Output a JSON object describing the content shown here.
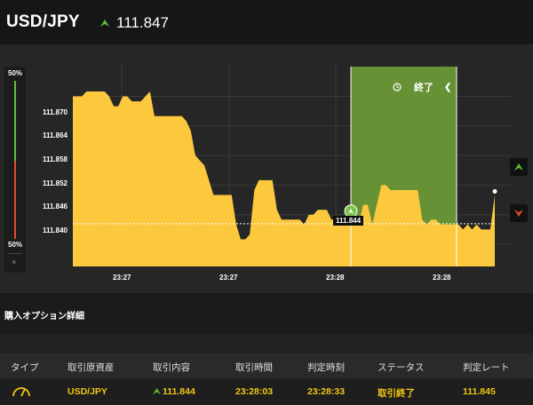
{
  "header": {
    "pair": "USD/JPY",
    "price": "111.847",
    "direction_icon": "up-arrow-icon",
    "up_color": "#5fbf3a"
  },
  "meter": {
    "top_label": "50%",
    "bottom_label": "50%",
    "close_label": "×"
  },
  "chart": {
    "y_ticks": [
      "111.870",
      "111.864",
      "111.858",
      "111.852",
      "111.846",
      "111.840"
    ],
    "x_ticks": [
      "23:27",
      "23:27",
      "23:28",
      "23:28"
    ],
    "current_label": "111.844",
    "end_label": "終了",
    "fill_color": "#fcc93e",
    "window_color": "#6b9a36"
  },
  "chart_data": {
    "type": "area",
    "y_tick_values": [
      111.87,
      111.864,
      111.858,
      111.852,
      111.846,
      111.84
    ],
    "ylim": [
      111.8355,
      111.8755
    ],
    "x_ticks": [
      "23:27",
      "23:27",
      "23:28",
      "23:28"
    ],
    "series": [
      {
        "values": [
          111.87,
          111.87,
          111.87,
          111.871,
          111.871,
          111.871,
          111.871,
          111.871,
          111.87,
          111.868,
          111.868,
          111.87,
          111.87,
          111.869,
          111.869,
          111.869,
          111.87,
          111.871,
          111.866,
          111.866,
          111.866,
          111.866,
          111.866,
          111.866,
          111.866,
          111.865,
          111.863,
          111.858,
          111.857,
          111.856,
          111.853,
          111.85,
          111.85,
          111.85,
          111.85,
          111.85,
          111.844,
          111.841,
          111.841,
          111.842,
          111.851,
          111.853,
          111.853,
          111.853,
          111.853,
          111.847,
          111.845,
          111.845,
          111.845,
          111.845,
          111.845,
          111.844,
          111.846,
          111.846,
          111.847,
          111.847,
          111.847,
          111.845,
          111.845,
          111.844,
          111.844,
          111.845,
          111.844,
          111.844,
          111.848,
          111.848,
          111.844,
          111.848,
          111.852,
          111.852,
          111.851,
          111.851,
          111.851,
          111.851,
          111.851,
          111.851,
          111.851,
          111.845,
          111.844,
          111.845,
          111.845,
          111.844,
          111.844,
          111.844,
          111.844,
          111.844,
          111.843,
          111.844,
          111.843,
          111.844,
          111.843,
          111.843,
          111.843,
          111.85
        ]
      }
    ],
    "entry_value": 111.846,
    "current_value": 111.844,
    "last_value": 111.85
  },
  "side_buttons": {
    "up_icon": "up-arrow-icon",
    "down_icon": "down-arrow-icon",
    "down_color": "#e04b2b"
  },
  "section": {
    "title": "購入オプション詳細"
  },
  "table": {
    "headers": [
      "タイプ",
      "取引原資産",
      "取引内容",
      "取引時間",
      "判定時刻",
      "ステータス",
      "判定レート"
    ],
    "row": {
      "type_icon": "gauge-icon",
      "asset": "USD/JPY",
      "content": "111.844",
      "trade_time": "23:28:03",
      "judge_time": "23:28:33",
      "status": "取引終了",
      "rate": "111.845"
    },
    "value_color": "#f2c811"
  }
}
